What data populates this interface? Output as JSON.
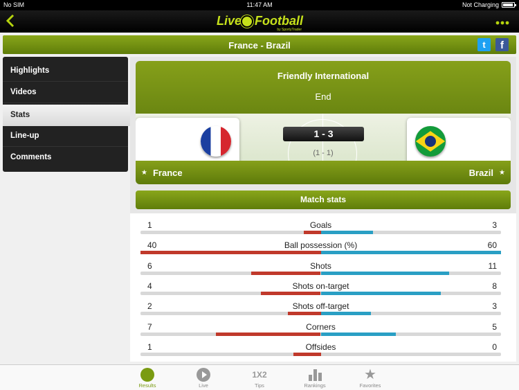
{
  "status_bar": {
    "carrier": "No SIM",
    "time": "11:47 AM",
    "charging": "Not Charging",
    "battery_level": 0.9
  },
  "nav": {
    "back_icon": "chevron-left-icon",
    "logo_left": "Live",
    "logo_right": "Football",
    "logo_sub": "by SportyTrader",
    "more_icon": "more-dots-icon"
  },
  "title_bar": {
    "title": "France - Brazil",
    "twitter_label": "t",
    "facebook_label": "f"
  },
  "sidebar": {
    "items": [
      {
        "label": "Highlights",
        "active": false
      },
      {
        "label": "Videos",
        "active": false
      },
      {
        "label": "Stats",
        "active": true
      },
      {
        "label": "Line-up",
        "active": false
      },
      {
        "label": "Comments",
        "active": false
      }
    ]
  },
  "match": {
    "competition": "Friendly International",
    "status": "End",
    "score": "1 - 3",
    "half_time": "(1 - 1)",
    "home": {
      "name": "France"
    },
    "away": {
      "name": "Brazil"
    }
  },
  "stats": {
    "header": "Match stats",
    "colors": {
      "home": "#c0392b",
      "away": "#2a9fc4"
    },
    "rows": [
      {
        "label": "Goals",
        "home": "1",
        "away": "3",
        "home_pct": 25,
        "away_pct": 75
      },
      {
        "label": "Ball possession (%)",
        "home": "40",
        "away": "60",
        "home_pct": 40,
        "away_pct": 60
      },
      {
        "label": "Shots",
        "home": "6",
        "away": "11",
        "home_pct": 35,
        "away_pct": 65
      },
      {
        "label": "Shots on-target",
        "home": "4",
        "away": "8",
        "home_pct": 33,
        "away_pct": 67
      },
      {
        "label": "Shots off-target",
        "home": "2",
        "away": "3",
        "home_pct": 40,
        "away_pct": 60
      },
      {
        "label": "Corners",
        "home": "7",
        "away": "5",
        "home_pct": 58,
        "away_pct": 42
      },
      {
        "label": "Offsides",
        "home": "1",
        "away": "0",
        "home_pct": 100,
        "away_pct": 0
      }
    ]
  },
  "tabs": [
    {
      "label": "Results",
      "active": true
    },
    {
      "label": "Live",
      "active": false
    },
    {
      "label": "Tips",
      "active": false,
      "icon_text": "1X2"
    },
    {
      "label": "Rankings",
      "active": false
    },
    {
      "label": "Favorites",
      "active": false
    }
  ]
}
